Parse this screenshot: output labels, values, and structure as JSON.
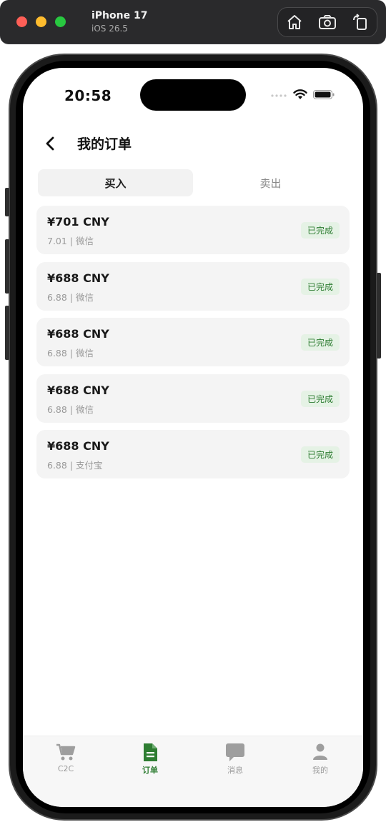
{
  "simulator": {
    "device_name": "iPhone 17",
    "os_version": "iOS 26.5",
    "tools": [
      {
        "icon": "home-icon"
      },
      {
        "icon": "screenshot-icon"
      },
      {
        "icon": "rotate-icon"
      }
    ]
  },
  "status_bar": {
    "time": "20:58"
  },
  "header": {
    "title": "我的订单",
    "back_icon": "chevron-left-icon"
  },
  "tabs": [
    {
      "label": "买入",
      "active": true
    },
    {
      "label": "卖出",
      "active": false
    }
  ],
  "orders": [
    {
      "amount": "¥701 CNY",
      "meta": "7.01 | 微信",
      "status": "已完成"
    },
    {
      "amount": "¥688 CNY",
      "meta": "6.88 | 微信",
      "status": "已完成"
    },
    {
      "amount": "¥688 CNY",
      "meta": "6.88 | 微信",
      "status": "已完成"
    },
    {
      "amount": "¥688 CNY",
      "meta": "6.88 | 微信",
      "status": "已完成"
    },
    {
      "amount": "¥688 CNY",
      "meta": "6.88 | 支付宝",
      "status": "已完成"
    }
  ],
  "tab_bar": [
    {
      "label": "C2C",
      "icon": "cart-icon",
      "active": false
    },
    {
      "label": "订单",
      "icon": "document-icon",
      "active": true
    },
    {
      "label": "消息",
      "icon": "chat-bubble-icon",
      "active": false
    },
    {
      "label": "我的",
      "icon": "person-icon",
      "active": false
    }
  ],
  "colors": {
    "accent_green": "#2e7d32",
    "badge_background": "#e5f2e5",
    "card_background": "#f4f4f4"
  }
}
